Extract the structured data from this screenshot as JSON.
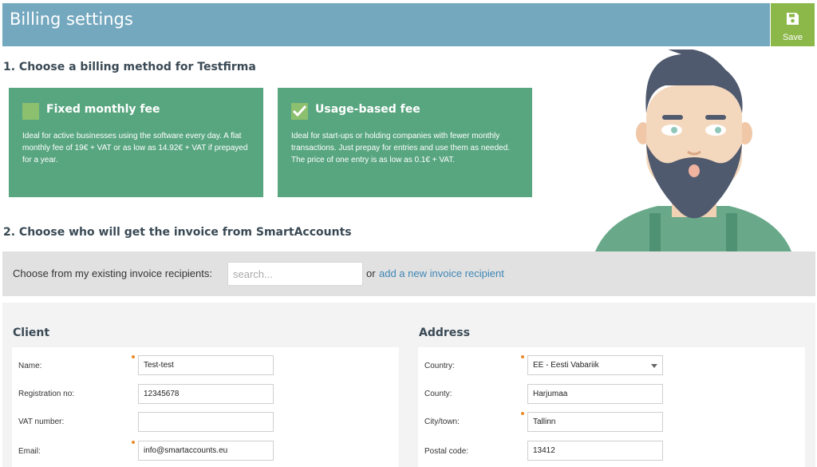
{
  "header": {
    "title": "Billing settings",
    "save_label": "Save"
  },
  "section1": {
    "title": "1. Choose a billing method for Testfirma",
    "cards": [
      {
        "title": "Fixed monthly fee",
        "checked": false,
        "description": "Ideal for active businesses using the software every day. A flat monthly fee of 19€ + VAT or as low as 14.92€ + VAT if prepayed for a year."
      },
      {
        "title": "Usage-based fee",
        "checked": true,
        "description": "Ideal for start-ups or holding companies with fewer monthly transactions. Just prepay for entries and use them as needed. The price of one entry is as low as 0.1€ + VAT."
      }
    ]
  },
  "section2": {
    "title": "2. Choose who will get the invoice from SmartAccounts"
  },
  "recipients": {
    "label": "Choose from my existing invoice recipients:",
    "search_placeholder": "search...",
    "or": "or",
    "add_link": "add a new invoice recipient"
  },
  "client": {
    "heading": "Client",
    "fields": [
      {
        "label": "Name:",
        "value": "Test-test",
        "required": true
      },
      {
        "label": "Registration no:",
        "value": "12345678",
        "required": false
      },
      {
        "label": "VAT number:",
        "value": "",
        "required": false
      },
      {
        "label": "Email:",
        "value": "info@smartaccounts.eu",
        "required": true
      }
    ]
  },
  "address": {
    "heading": "Address",
    "fields": [
      {
        "label": "Country:",
        "value": "EE - Eesti Vabariik",
        "required": true,
        "type": "select"
      },
      {
        "label": "County:",
        "value": "Harjumaa",
        "required": false
      },
      {
        "label": "City/town:",
        "value": "Tallinn",
        "required": true
      },
      {
        "label": "Postal code:",
        "value": "13412",
        "required": false
      }
    ]
  },
  "colors": {
    "header": "#74a8bf",
    "save": "#8cb84a",
    "card": "#58a680",
    "link": "#3f86b5",
    "required_dot": "#e98a2b"
  }
}
